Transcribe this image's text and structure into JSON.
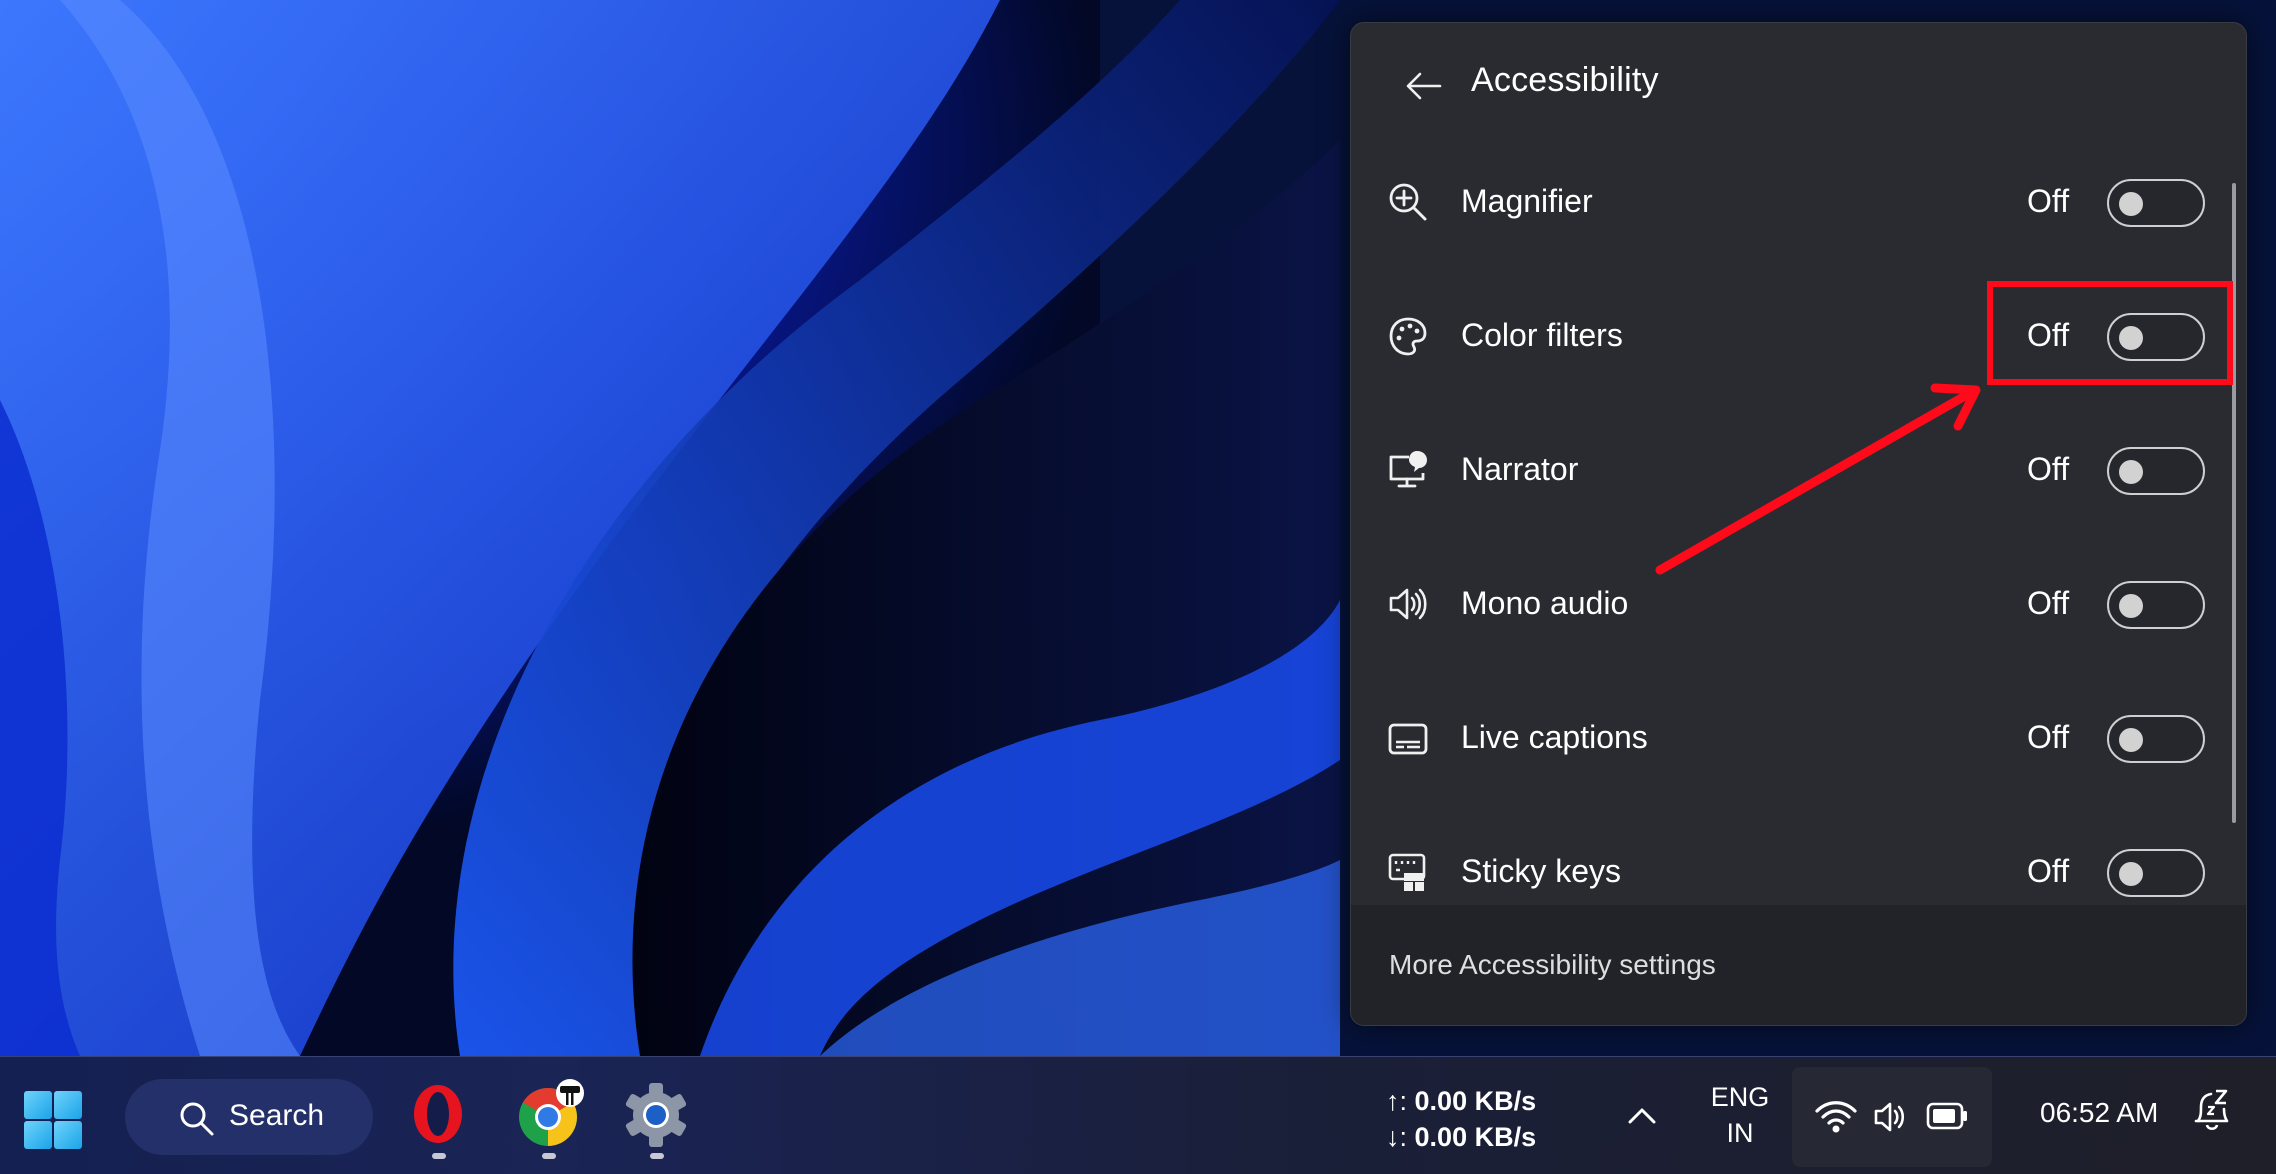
{
  "panel": {
    "title": "Accessibility",
    "back_label": "Back",
    "items": [
      {
        "label": "Magnifier",
        "state": "Off",
        "on": false,
        "icon": "magnifier-icon"
      },
      {
        "label": "Color filters",
        "state": "Off",
        "on": false,
        "icon": "color-palette-icon"
      },
      {
        "label": "Narrator",
        "state": "Off",
        "on": false,
        "icon": "narrator-icon"
      },
      {
        "label": "Mono audio",
        "state": "Off",
        "on": false,
        "icon": "speaker-icon"
      },
      {
        "label": "Live captions",
        "state": "Off",
        "on": false,
        "icon": "captions-icon"
      },
      {
        "label": "Sticky keys",
        "state": "Off",
        "on": false,
        "icon": "keyboard-icon"
      }
    ],
    "footer_link": "More Accessibility settings"
  },
  "annotation": {
    "highlighted_item": "Color filters",
    "color": "#ff0a1a"
  },
  "taskbar": {
    "search_label": "Search",
    "apps": [
      {
        "name": "Opera",
        "icon": "opera-icon"
      },
      {
        "name": "Google Chrome",
        "icon": "chrome-icon"
      },
      {
        "name": "Settings",
        "icon": "settings-gear-icon"
      }
    ],
    "net_upload_prefix": "↑:",
    "net_upload": "0.00 KB/s",
    "net_download_prefix": "↓:",
    "net_download": "0.00 KB/s",
    "lang_line1": "ENG",
    "lang_line2": "IN",
    "clock": "06:52 AM"
  },
  "colors": {
    "panel_bg": "#2a2b31",
    "footer_bg": "#222328",
    "accent_red": "#ff0a1a",
    "windows_blue": "#29b6f6"
  }
}
